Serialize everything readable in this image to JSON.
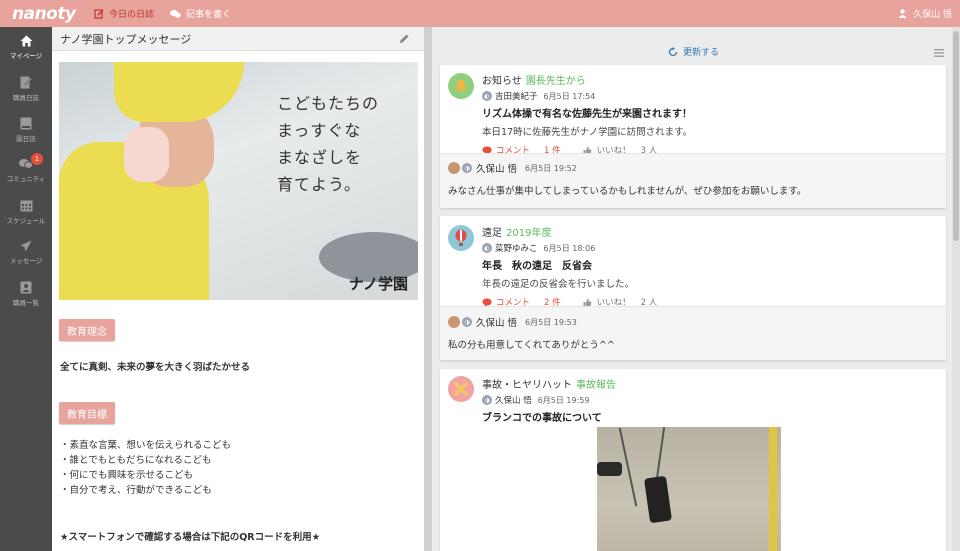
{
  "header": {
    "logo": "nanoty",
    "nav": [
      {
        "label": "今日の日誌",
        "icon": "diary-edit-icon",
        "active": true
      },
      {
        "label": "記事を書く",
        "icon": "chat-bubbles-icon",
        "active": false
      }
    ],
    "user_name": "久保山 悟"
  },
  "sidebar": {
    "items": [
      {
        "label": "マイページ",
        "icon": "home-icon",
        "active": true
      },
      {
        "label": "職員日誌",
        "icon": "staff-diary-icon"
      },
      {
        "label": "園日誌",
        "icon": "book-icon"
      },
      {
        "label": "コミュニティ",
        "icon": "community-icon",
        "badge": "1"
      },
      {
        "label": "スケジュール",
        "icon": "calendar-icon"
      },
      {
        "label": "メッセージ",
        "icon": "paper-plane-icon"
      },
      {
        "label": "職員一覧",
        "icon": "staff-list-icon"
      }
    ]
  },
  "left_panel": {
    "title": "ナノ学園トップメッセージ",
    "hero_tagline": "こどもたちの\nまっすぐな\nまなざしを\n育てよう。",
    "hero_brand": "ナノ学園",
    "philosophy_label": "教育理念",
    "philosophy_text": "全てに真剣、未来の夢を大きく羽ばたかせる",
    "goals_label": "教育目標",
    "goals": [
      "・素直な言葉、想いを伝えられるこども",
      "・誰とでもともだちになれるこども",
      "・何にでも興味を示せるこども",
      "・自分で考え、行動ができるこども"
    ],
    "qr_note": "★スマートフォンで確認する場合は下記のQRコードを利用★"
  },
  "feed": {
    "refresh_label": "更新する",
    "posts": [
      {
        "category": "お知らせ",
        "subcategory": "園長先生から",
        "author": "吉田美紀子",
        "date": "6月5日 17:54",
        "title": "リズム体操で有名な佐藤先生が来園されます！",
        "body": "本日17時に佐藤先生がナノ学園に訪問されます。",
        "comment_label": "コメント",
        "comment_count": "1 件",
        "like_label": "いいね！",
        "like_count": "3 人",
        "comment": {
          "author": "久保山 悟",
          "date": "6月5日 19:52",
          "body": "みなさん仕事が集中してしまっているかもしれませんが、ぜひ参加をお願いします。"
        }
      },
      {
        "category": "遠足",
        "subcategory": "2019年度",
        "author": "菜野ゆみこ",
        "date": "6月5日 18:06",
        "title": "年長　秋の遠足　反省会",
        "body": "年長の遠足の反省会を行いました。",
        "comment_label": "コメント",
        "comment_count": "2 件",
        "like_label": "いいね！",
        "like_count": "2 人",
        "comment": {
          "author": "久保山 悟",
          "date": "6月5日 19:53",
          "body": "私の分も用意してくれてありがとう^^"
        }
      },
      {
        "category": "事故・ヒヤリハット",
        "subcategory": "事故報告",
        "author": "久保山 悟",
        "date": "6月5日 19:59",
        "title": "ブランコでの事故について"
      }
    ]
  },
  "colors": {
    "brand": "#e7a39c",
    "sidebar": "#4b4b4b",
    "accent_green": "#5cb85c",
    "link_blue": "#2c7ab7",
    "comment_red": "#e84c3d"
  }
}
